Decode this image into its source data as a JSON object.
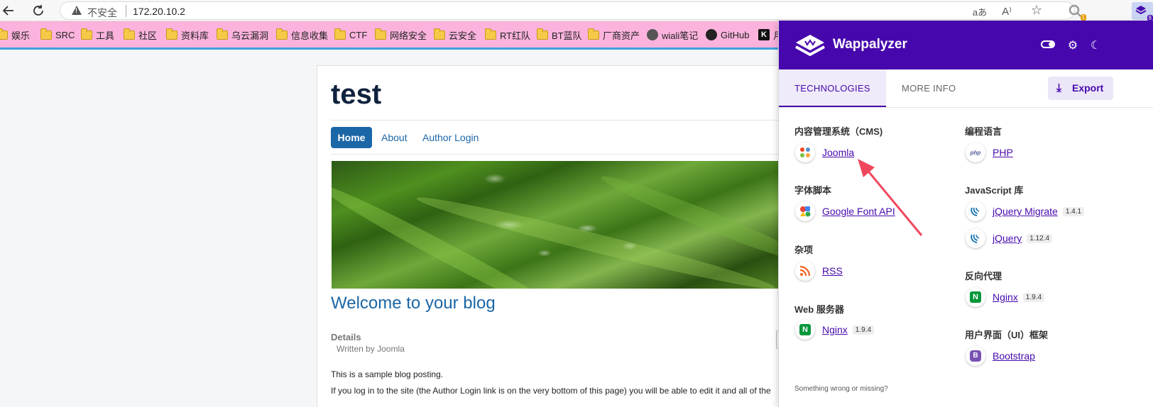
{
  "browser": {
    "security_label": "不安全",
    "url": "172.20.10.2",
    "tools": {
      "translate_icon": "aあ",
      "read_aloud_icon": "A⁾",
      "favorite_icon": "☆"
    },
    "extension_badge": "1",
    "extension_badge2": "8"
  },
  "bookmarks": [
    {
      "label": "娱乐",
      "icon": "folder-icon"
    },
    {
      "label": "SRC",
      "icon": "folder-icon"
    },
    {
      "label": "工具",
      "icon": "folder-icon"
    },
    {
      "label": "社区",
      "icon": "folder-icon"
    },
    {
      "label": "资料库",
      "icon": "folder-icon"
    },
    {
      "label": "乌云漏洞",
      "icon": "folder-icon"
    },
    {
      "label": "信息收集",
      "icon": "folder-icon"
    },
    {
      "label": "CTF",
      "icon": "folder-icon"
    },
    {
      "label": "网络安全",
      "icon": "folder-icon"
    },
    {
      "label": "云安全",
      "icon": "folder-icon"
    },
    {
      "label": "RT红队",
      "icon": "folder-icon"
    },
    {
      "label": "BT蓝队",
      "icon": "folder-icon"
    },
    {
      "label": "厂商资产",
      "icon": "folder-icon"
    },
    {
      "label": "wiali笔记",
      "icon": "avatar-icon"
    },
    {
      "label": "GitHub",
      "icon": "github-icon"
    },
    {
      "label": "月",
      "icon": "k-icon",
      "k_letter": "K"
    }
  ],
  "site": {
    "title": "test",
    "nav": [
      "Home",
      "About",
      "Author Login"
    ],
    "post_title": "Welcome to your blog",
    "details_label": "Details",
    "written_by": "Written by Joomla",
    "gear_icon": "⚙",
    "body_line1": "This is a sample blog posting.",
    "body_line2": "If you log in to the site (the Author Login link is on the very bottom of this page) you will be able to edit it and all of the"
  },
  "wappalyzer": {
    "brand": "Wappalyzer",
    "header_icons": {
      "settings": "⚙",
      "dark_mode": "☾"
    },
    "tabs": {
      "technologies": "TECHNOLOGIES",
      "more_info": "MORE INFO"
    },
    "export_label": "Export",
    "export_icon": "⤓",
    "categories_left": [
      {
        "title": "内容管理系统（CMS)",
        "items": [
          {
            "name": "Joomla",
            "icon": "joomla-icon",
            "version": ""
          }
        ]
      },
      {
        "title": "字体脚本",
        "items": [
          {
            "name": "Google Font API",
            "icon": "google-font-icon",
            "version": ""
          }
        ]
      },
      {
        "title": "杂项",
        "items": [
          {
            "name": "RSS",
            "icon": "rss-icon",
            "version": ""
          }
        ]
      },
      {
        "title": "Web 服务器",
        "items": [
          {
            "name": "Nginx",
            "icon": "nginx-icon",
            "version": "1.9.4"
          }
        ]
      }
    ],
    "categories_right": [
      {
        "title": "编程语言",
        "items": [
          {
            "name": "PHP",
            "icon": "php-icon",
            "version": ""
          }
        ]
      },
      {
        "title": "JavaScript 库",
        "items": [
          {
            "name": "jQuery Migrate",
            "icon": "jquery-icon",
            "version": "1.4.1"
          },
          {
            "name": "jQuery",
            "icon": "jquery-icon",
            "version": "1.12.4"
          }
        ]
      },
      {
        "title": "反向代理",
        "items": [
          {
            "name": "Nginx",
            "icon": "nginx-icon",
            "version": "1.9.4"
          }
        ]
      },
      {
        "title": "用户界面（UI）框架",
        "items": [
          {
            "name": "Bootstrap",
            "icon": "bootstrap-icon",
            "version": ""
          }
        ]
      }
    ],
    "footer": "Something wrong or missing?",
    "icon_glyphs": {
      "php": "php",
      "nginx": "N",
      "bootstrap": "B"
    }
  },
  "colors": {
    "wappalyzer_purple": "#4608ad",
    "joomla_blue": "#1b66a7",
    "bookmark_bar": "#fbb3dd",
    "annotation_arrow": "#f0475f"
  }
}
